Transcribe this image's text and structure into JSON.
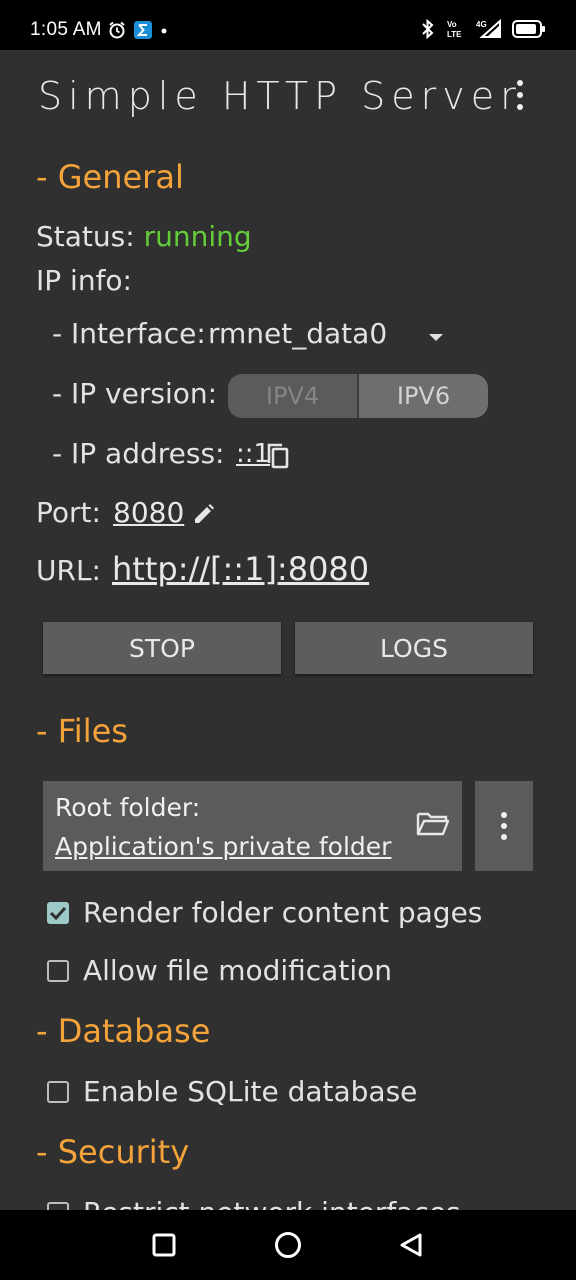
{
  "status_bar": {
    "time": "1:05 AM",
    "icons": [
      "alarm-icon",
      "sigma-app-icon",
      "dot-icon",
      "bluetooth-icon",
      "volte-icon",
      "signal-4g-icon",
      "battery-icon"
    ],
    "volte_text": "Vo\nLTE",
    "network_text": "4G"
  },
  "app": {
    "title": "Simple HTTP Server",
    "menu_icon": "more-vert-icon"
  },
  "general": {
    "header": "- General",
    "status_label": "Status:",
    "status_value": "running",
    "ip_info_label": "IP info:",
    "interface_label": "- Interface:",
    "interface_value": "rmnet_data0",
    "ip_version_label": "- IP version:",
    "ip_versions": [
      "IPV4",
      "IPV6"
    ],
    "ip_version_selected": "IPV6",
    "ip_address_label": "- IP address:",
    "ip_address_value": "::1",
    "port_label": "Port:",
    "port_value": "8080",
    "url_label": "URL:",
    "url_value": "http://[::1]:8080",
    "stop_label": "STOP",
    "logs_label": "LOGS"
  },
  "files": {
    "header": "- Files",
    "root_folder_title": "Root folder:",
    "root_folder_value": "Application's private folder",
    "render_folder_label": "Render folder content pages",
    "render_folder_checked": true,
    "allow_modification_label": "Allow file modification",
    "allow_modification_checked": false
  },
  "database": {
    "header": "- Database",
    "sqlite_label": "Enable SQLite database",
    "sqlite_checked": false
  },
  "security": {
    "header": "- Security",
    "restrict_label": "Restrict network interfaces"
  },
  "colors": {
    "background": "#303030",
    "accent_orange": "#f4a33a",
    "status_green": "#63cc3b",
    "button_grey": "#5d5d5d",
    "checkbox_teal": "#9ec9c9"
  },
  "nav_bar": {
    "icons": [
      "recents-square-icon",
      "home-circle-icon",
      "back-triangle-icon"
    ]
  }
}
